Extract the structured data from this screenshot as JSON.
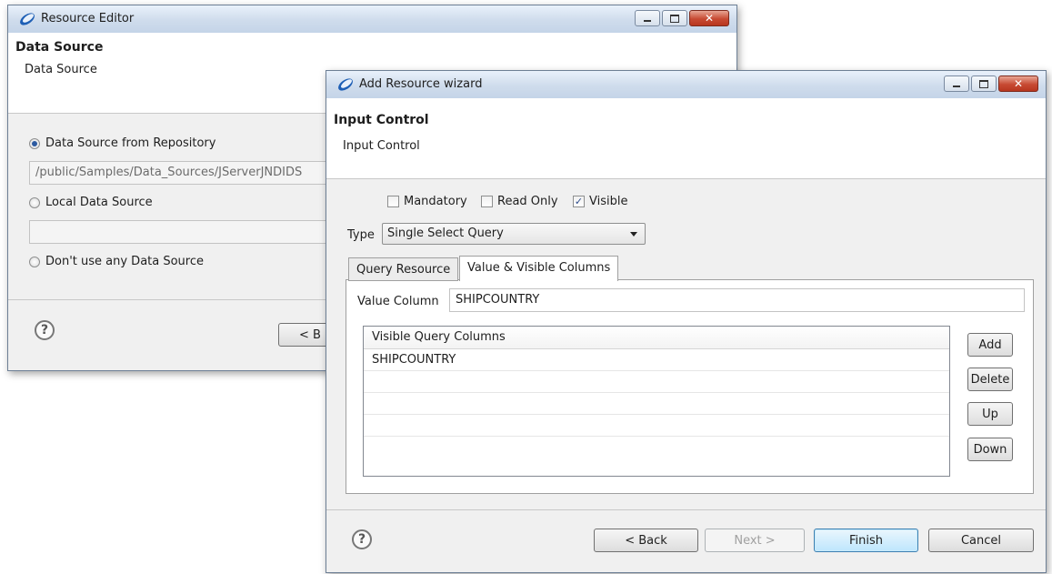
{
  "resource_editor": {
    "title": "Resource Editor",
    "header_title": "Data Source",
    "header_subtitle": "Data Source",
    "radio_repository": "Data Source from Repository",
    "repository_path": "/public/Samples/Data_Sources/JServerJNDIDS",
    "radio_local": "Local Data Source",
    "radio_none": "Don't use any Data Source",
    "back_partial": "< B",
    "help": "?"
  },
  "wizard": {
    "title": "Add Resource wizard",
    "header_title": "Input Control",
    "header_subtitle": "Input Control",
    "mandatory": {
      "label": "Mandatory",
      "checked": false
    },
    "read_only": {
      "label": "Read Only",
      "checked": false
    },
    "visible": {
      "label": "Visible",
      "checked": true
    },
    "type_label": "Type",
    "type_value": "Single Select Query",
    "tabs": [
      {
        "label": "Query Resource",
        "active": false
      },
      {
        "label": "Value & Visible Columns",
        "active": true
      }
    ],
    "value_column_label": "Value Column",
    "value_column_value": "SHIPCOUNTRY",
    "table_header": "Visible Query Columns",
    "rows": [
      "SHIPCOUNTRY",
      "",
      "",
      "",
      ""
    ],
    "side_buttons": {
      "add": "Add",
      "delete": "Delete",
      "up": "Up",
      "down": "Down"
    },
    "help": "?",
    "buttons": {
      "back": "< Back",
      "next": "Next >",
      "finish": "Finish",
      "cancel": "Cancel"
    }
  },
  "colors": {
    "accent": "#2c5aa0",
    "close_red": "#c74a33",
    "titlebar": "#cfdcec"
  },
  "icons": {
    "app": "eclipse-app-icon",
    "minimize": "minimize-icon",
    "maximize": "maximize-icon",
    "close": "close-icon",
    "help": "help-icon"
  }
}
